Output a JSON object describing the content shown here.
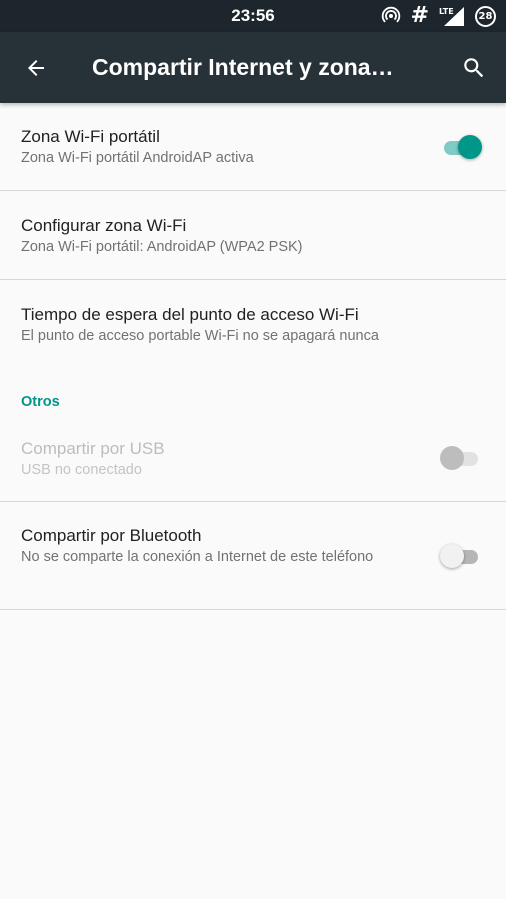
{
  "status_bar": {
    "time": "23:56",
    "battery_level": "28",
    "signal_type": "LTE",
    "icons": [
      "hotspot-icon",
      "hash-icon",
      "lte-signal-icon",
      "battery-icon"
    ]
  },
  "toolbar": {
    "title": "Compartir Internet y zona…",
    "back_icon": "arrow-back-icon",
    "search_icon": "search-icon",
    "background": "#263238"
  },
  "settings": {
    "hotspot": {
      "title": "Zona Wi-Fi portátil",
      "summary": "Zona Wi-Fi portátil AndroidAP activa",
      "enabled": true
    },
    "configure": {
      "title": "Configurar zona Wi-Fi",
      "summary": "Zona Wi-Fi portátil: AndroidAP (WPA2 PSK)"
    },
    "timeout": {
      "title": "Tiempo de espera del punto de acceso Wi-Fi",
      "summary": "El punto de acceso portable Wi-Fi no se apagará nunca"
    },
    "category_other": "Otros",
    "usb": {
      "title": "Compartir por USB",
      "summary": "USB no conectado",
      "enabled": false,
      "disabled": true
    },
    "bluetooth": {
      "title": "Compartir por Bluetooth",
      "summary": "No se comparte la conexión a Internet de este teléfono",
      "enabled": false
    }
  },
  "colors": {
    "accent": "#009688",
    "background": "#fafafa",
    "status_bar": "#1c262c"
  }
}
